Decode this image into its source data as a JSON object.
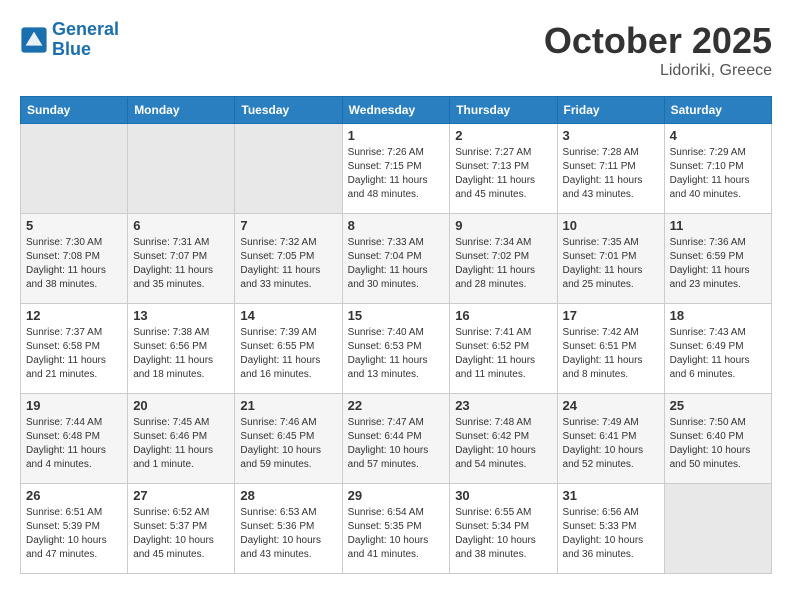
{
  "header": {
    "logo_line1": "General",
    "logo_line2": "Blue",
    "month": "October 2025",
    "location": "Lidoriki, Greece"
  },
  "weekdays": [
    "Sunday",
    "Monday",
    "Tuesday",
    "Wednesday",
    "Thursday",
    "Friday",
    "Saturday"
  ],
  "weeks": [
    [
      {
        "day": "",
        "info": ""
      },
      {
        "day": "",
        "info": ""
      },
      {
        "day": "",
        "info": ""
      },
      {
        "day": "1",
        "info": "Sunrise: 7:26 AM\nSunset: 7:15 PM\nDaylight: 11 hours\nand 48 minutes."
      },
      {
        "day": "2",
        "info": "Sunrise: 7:27 AM\nSunset: 7:13 PM\nDaylight: 11 hours\nand 45 minutes."
      },
      {
        "day": "3",
        "info": "Sunrise: 7:28 AM\nSunset: 7:11 PM\nDaylight: 11 hours\nand 43 minutes."
      },
      {
        "day": "4",
        "info": "Sunrise: 7:29 AM\nSunset: 7:10 PM\nDaylight: 11 hours\nand 40 minutes."
      }
    ],
    [
      {
        "day": "5",
        "info": "Sunrise: 7:30 AM\nSunset: 7:08 PM\nDaylight: 11 hours\nand 38 minutes."
      },
      {
        "day": "6",
        "info": "Sunrise: 7:31 AM\nSunset: 7:07 PM\nDaylight: 11 hours\nand 35 minutes."
      },
      {
        "day": "7",
        "info": "Sunrise: 7:32 AM\nSunset: 7:05 PM\nDaylight: 11 hours\nand 33 minutes."
      },
      {
        "day": "8",
        "info": "Sunrise: 7:33 AM\nSunset: 7:04 PM\nDaylight: 11 hours\nand 30 minutes."
      },
      {
        "day": "9",
        "info": "Sunrise: 7:34 AM\nSunset: 7:02 PM\nDaylight: 11 hours\nand 28 minutes."
      },
      {
        "day": "10",
        "info": "Sunrise: 7:35 AM\nSunset: 7:01 PM\nDaylight: 11 hours\nand 25 minutes."
      },
      {
        "day": "11",
        "info": "Sunrise: 7:36 AM\nSunset: 6:59 PM\nDaylight: 11 hours\nand 23 minutes."
      }
    ],
    [
      {
        "day": "12",
        "info": "Sunrise: 7:37 AM\nSunset: 6:58 PM\nDaylight: 11 hours\nand 21 minutes."
      },
      {
        "day": "13",
        "info": "Sunrise: 7:38 AM\nSunset: 6:56 PM\nDaylight: 11 hours\nand 18 minutes."
      },
      {
        "day": "14",
        "info": "Sunrise: 7:39 AM\nSunset: 6:55 PM\nDaylight: 11 hours\nand 16 minutes."
      },
      {
        "day": "15",
        "info": "Sunrise: 7:40 AM\nSunset: 6:53 PM\nDaylight: 11 hours\nand 13 minutes."
      },
      {
        "day": "16",
        "info": "Sunrise: 7:41 AM\nSunset: 6:52 PM\nDaylight: 11 hours\nand 11 minutes."
      },
      {
        "day": "17",
        "info": "Sunrise: 7:42 AM\nSunset: 6:51 PM\nDaylight: 11 hours\nand 8 minutes."
      },
      {
        "day": "18",
        "info": "Sunrise: 7:43 AM\nSunset: 6:49 PM\nDaylight: 11 hours\nand 6 minutes."
      }
    ],
    [
      {
        "day": "19",
        "info": "Sunrise: 7:44 AM\nSunset: 6:48 PM\nDaylight: 11 hours\nand 4 minutes."
      },
      {
        "day": "20",
        "info": "Sunrise: 7:45 AM\nSunset: 6:46 PM\nDaylight: 11 hours\nand 1 minute."
      },
      {
        "day": "21",
        "info": "Sunrise: 7:46 AM\nSunset: 6:45 PM\nDaylight: 10 hours\nand 59 minutes."
      },
      {
        "day": "22",
        "info": "Sunrise: 7:47 AM\nSunset: 6:44 PM\nDaylight: 10 hours\nand 57 minutes."
      },
      {
        "day": "23",
        "info": "Sunrise: 7:48 AM\nSunset: 6:42 PM\nDaylight: 10 hours\nand 54 minutes."
      },
      {
        "day": "24",
        "info": "Sunrise: 7:49 AM\nSunset: 6:41 PM\nDaylight: 10 hours\nand 52 minutes."
      },
      {
        "day": "25",
        "info": "Sunrise: 7:50 AM\nSunset: 6:40 PM\nDaylight: 10 hours\nand 50 minutes."
      }
    ],
    [
      {
        "day": "26",
        "info": "Sunrise: 6:51 AM\nSunset: 5:39 PM\nDaylight: 10 hours\nand 47 minutes."
      },
      {
        "day": "27",
        "info": "Sunrise: 6:52 AM\nSunset: 5:37 PM\nDaylight: 10 hours\nand 45 minutes."
      },
      {
        "day": "28",
        "info": "Sunrise: 6:53 AM\nSunset: 5:36 PM\nDaylight: 10 hours\nand 43 minutes."
      },
      {
        "day": "29",
        "info": "Sunrise: 6:54 AM\nSunset: 5:35 PM\nDaylight: 10 hours\nand 41 minutes."
      },
      {
        "day": "30",
        "info": "Sunrise: 6:55 AM\nSunset: 5:34 PM\nDaylight: 10 hours\nand 38 minutes."
      },
      {
        "day": "31",
        "info": "Sunrise: 6:56 AM\nSunset: 5:33 PM\nDaylight: 10 hours\nand 36 minutes."
      },
      {
        "day": "",
        "info": ""
      }
    ]
  ]
}
